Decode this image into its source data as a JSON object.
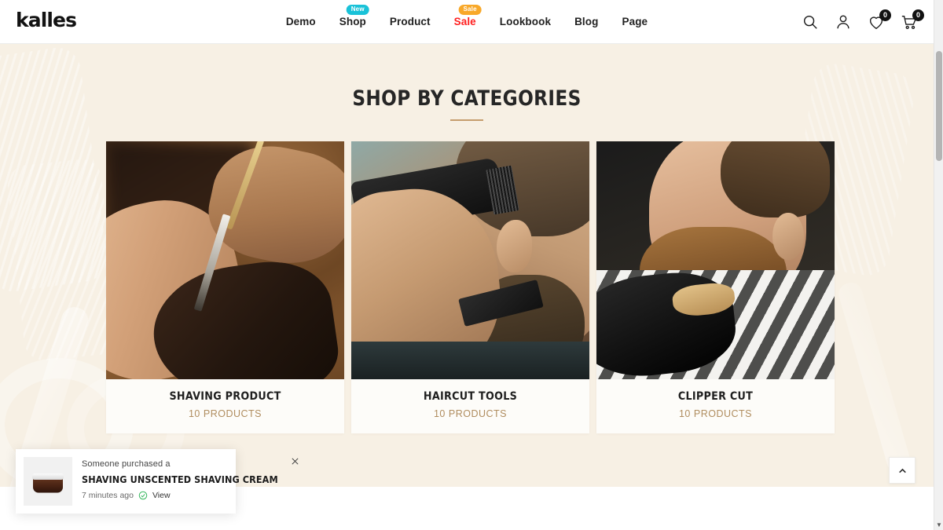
{
  "header": {
    "logo": "kalles",
    "nav": [
      {
        "label": "Demo",
        "badge": null,
        "badge_kind": null,
        "highlight": false
      },
      {
        "label": "Shop",
        "badge": "New",
        "badge_kind": "new",
        "highlight": false
      },
      {
        "label": "Product",
        "badge": null,
        "badge_kind": null,
        "highlight": false
      },
      {
        "label": "Sale",
        "badge": "Sale",
        "badge_kind": "sale",
        "highlight": true
      },
      {
        "label": "Lookbook",
        "badge": null,
        "badge_kind": null,
        "highlight": false
      },
      {
        "label": "Blog",
        "badge": null,
        "badge_kind": null,
        "highlight": false
      },
      {
        "label": "Page",
        "badge": null,
        "badge_kind": null,
        "highlight": false
      }
    ],
    "icons": {
      "search": "search-icon",
      "account": "user-icon",
      "wishlist": "heart-icon",
      "wishlist_count": "0",
      "cart": "cart-icon",
      "cart_count": "0"
    }
  },
  "main": {
    "section_title": "SHOP BY CATEGORIES",
    "categories": [
      {
        "name": "SHAVING PRODUCT",
        "count": "10 PRODUCTS",
        "image_alt": "barber-shaving-beard-with-straight-razor"
      },
      {
        "name": "HAIRCUT TOOLS",
        "count": "10 PRODUCTS",
        "image_alt": "hair-clipper-trimming-nape"
      },
      {
        "name": "CLIPPER CUT",
        "count": "10 PRODUCTS",
        "image_alt": "bearded-man-beard-brush-striped-cape"
      }
    ]
  },
  "popup": {
    "line1": "Someone purchased a",
    "product": "SHAVING UNSCENTED SHAVING CREAM",
    "time": "7 minutes ago",
    "view_label": "View",
    "thumb_alt": "shaving-cream-jar"
  },
  "controls": {
    "back_to_top": "back-to-top",
    "scrollbar": "vertical-scrollbar"
  },
  "colors": {
    "page_background": "#f7f0e4",
    "header_background": "#ffffff",
    "accent_gold": "#b08d5f",
    "rule_gold": "#c59d6d",
    "badge_new": "#19c2d8",
    "badge_sale": "#f8a829",
    "sale_text": "#ff2020",
    "text_dark": "#1f1f1f",
    "check_green": "#35b75c"
  }
}
